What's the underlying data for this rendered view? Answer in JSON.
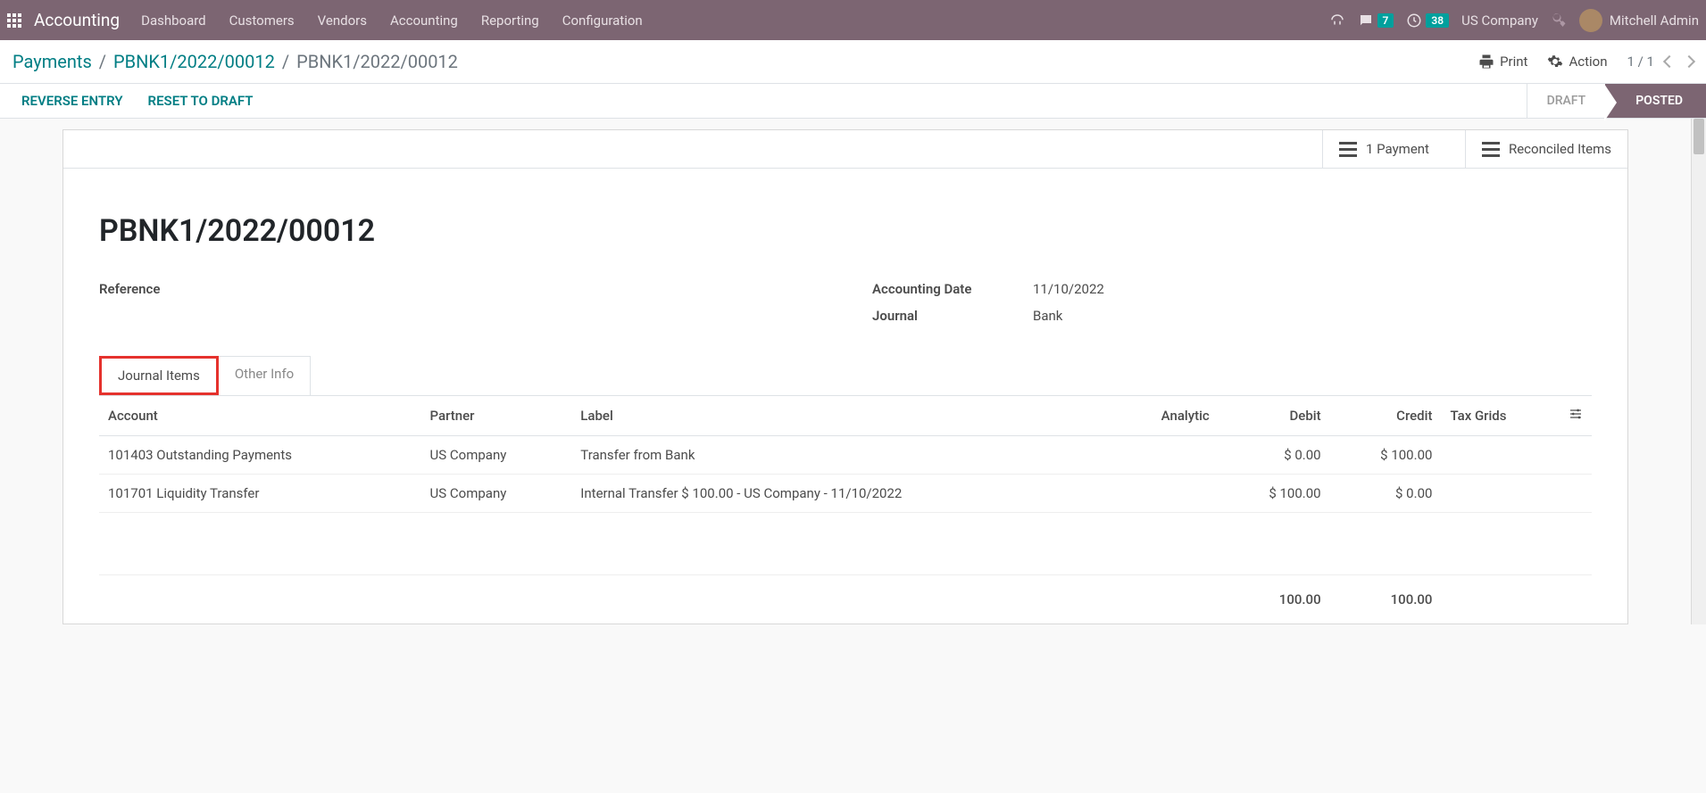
{
  "navbar": {
    "brand": "Accounting",
    "menu": [
      "Dashboard",
      "Customers",
      "Vendors",
      "Accounting",
      "Reporting",
      "Configuration"
    ],
    "chat_badge": "7",
    "clock_badge": "38",
    "company": "US Company",
    "user": "Mitchell Admin"
  },
  "breadcrumb": {
    "root": "Payments",
    "mid": "PBNK1/2022/00012",
    "leaf": "PBNK1/2022/00012",
    "print": "Print",
    "action": "Action",
    "pager": "1 / 1"
  },
  "action_bar": {
    "reverse": "REVERSE ENTRY",
    "reset": "RESET TO DRAFT",
    "draft": "DRAFT",
    "posted": "POSTED"
  },
  "button_box": {
    "payment": "1 Payment",
    "reconciled": "Reconciled Items"
  },
  "form": {
    "title": "PBNK1/2022/00012",
    "reference_label": "Reference",
    "reference_value": "",
    "date_label": "Accounting Date",
    "date_value": "11/10/2022",
    "journal_label": "Journal",
    "journal_value": "Bank"
  },
  "tabs": {
    "journal_items": "Journal Items",
    "other_info": "Other Info"
  },
  "table": {
    "headers": {
      "account": "Account",
      "partner": "Partner",
      "label": "Label",
      "analytic": "Analytic",
      "debit": "Debit",
      "credit": "Credit",
      "tax_grids": "Tax Grids"
    },
    "rows": [
      {
        "account": "101403 Outstanding Payments",
        "partner": "US Company",
        "label": "Transfer from Bank",
        "analytic": "",
        "debit": "$ 0.00",
        "credit": "$ 100.00",
        "tax_grids": ""
      },
      {
        "account": "101701 Liquidity Transfer",
        "partner": "US Company",
        "label": "Internal Transfer $ 100.00 - US Company - 11/10/2022",
        "analytic": "",
        "debit": "$ 100.00",
        "credit": "$ 0.00",
        "tax_grids": ""
      }
    ],
    "totals": {
      "debit": "100.00",
      "credit": "100.00"
    }
  }
}
